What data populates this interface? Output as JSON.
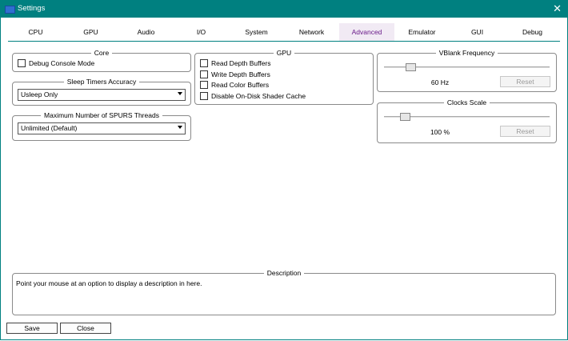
{
  "window": {
    "title": "Settings",
    "close_glyph": "✕",
    "app_icon": "rpcs3-icon"
  },
  "tabs": [
    {
      "label": "CPU"
    },
    {
      "label": "GPU"
    },
    {
      "label": "Audio"
    },
    {
      "label": "I/O"
    },
    {
      "label": "System"
    },
    {
      "label": "Network"
    },
    {
      "label": "Advanced",
      "active": true
    },
    {
      "label": "Emulator"
    },
    {
      "label": "GUI"
    },
    {
      "label": "Debug"
    }
  ],
  "core": {
    "title": "Core",
    "debug_console_mode": "Debug Console Mode"
  },
  "sleep_timers": {
    "title": "Sleep Timers Accuracy",
    "selected": "Usleep Only"
  },
  "spurs_threads": {
    "title": "Maximum Number of SPURS Threads",
    "selected": "Unlimited (Default)"
  },
  "gpu": {
    "title": "GPU",
    "options": [
      "Read Depth Buffers",
      "Write Depth Buffers",
      "Read Color Buffers",
      "Disable On-Disk Shader Cache"
    ]
  },
  "vblank": {
    "title": "VBlank Frequency",
    "value_label": "60 Hz",
    "reset_label": "Reset",
    "slider_fraction": 0.14
  },
  "clocks": {
    "title": "Clocks Scale",
    "value_label": "100 %",
    "reset_label": "Reset",
    "slider_fraction": 0.1
  },
  "description": {
    "title": "Description",
    "text": "Point your mouse at an option to display a description in here."
  },
  "footer": {
    "save_label": "Save",
    "close_label": "Close"
  },
  "colors": {
    "accent": "#008080",
    "active_tab_text": "#6a1b8a"
  }
}
